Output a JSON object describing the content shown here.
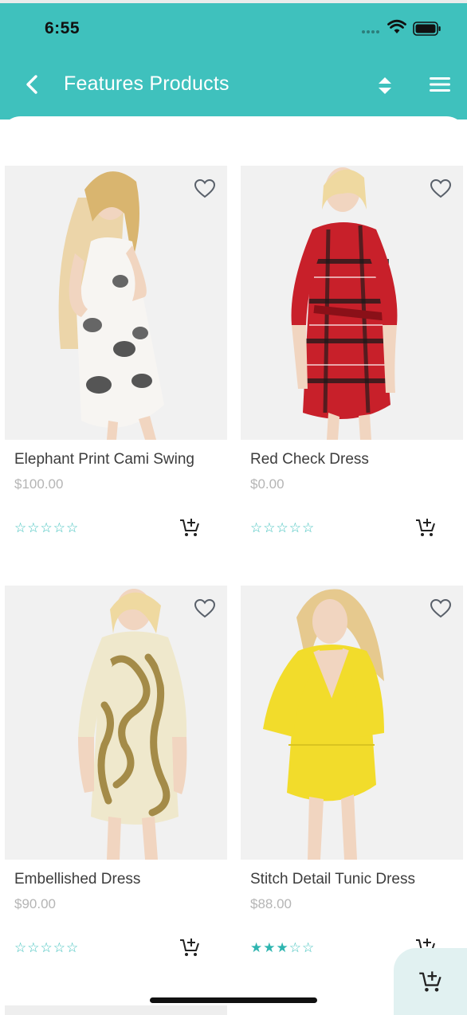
{
  "status_bar": {
    "time": "6:55"
  },
  "nav": {
    "title": "Features Products"
  },
  "colors": {
    "accent": "#3fc1bd",
    "star": "#3fc1bd",
    "price": "#b5b5b5"
  },
  "icons": {
    "back": "back-arrow-icon",
    "sort": "sort-icon",
    "menu": "hamburger-menu-icon",
    "favorite": "heart-outline-icon",
    "cart": "add-to-cart-icon"
  },
  "products": [
    {
      "name": "Elephant Print Cami Swing",
      "price": "$100.00",
      "rating": 0,
      "max_rating": 5,
      "image": "model-in-white-elephant-print-dress"
    },
    {
      "name": "Red Check Dress",
      "price": "$0.00",
      "rating": 0,
      "max_rating": 5,
      "image": "model-in-red-plaid-shirt-dress"
    },
    {
      "name": "Embellished Dress",
      "price": "$90.00",
      "rating": 0,
      "max_rating": 5,
      "image": "model-in-gold-embellished-dress"
    },
    {
      "name": "Stitch Detail Tunic Dress",
      "price": "$88.00",
      "rating": 3,
      "max_rating": 5,
      "image": "model-in-yellow-tunic-dress"
    }
  ]
}
